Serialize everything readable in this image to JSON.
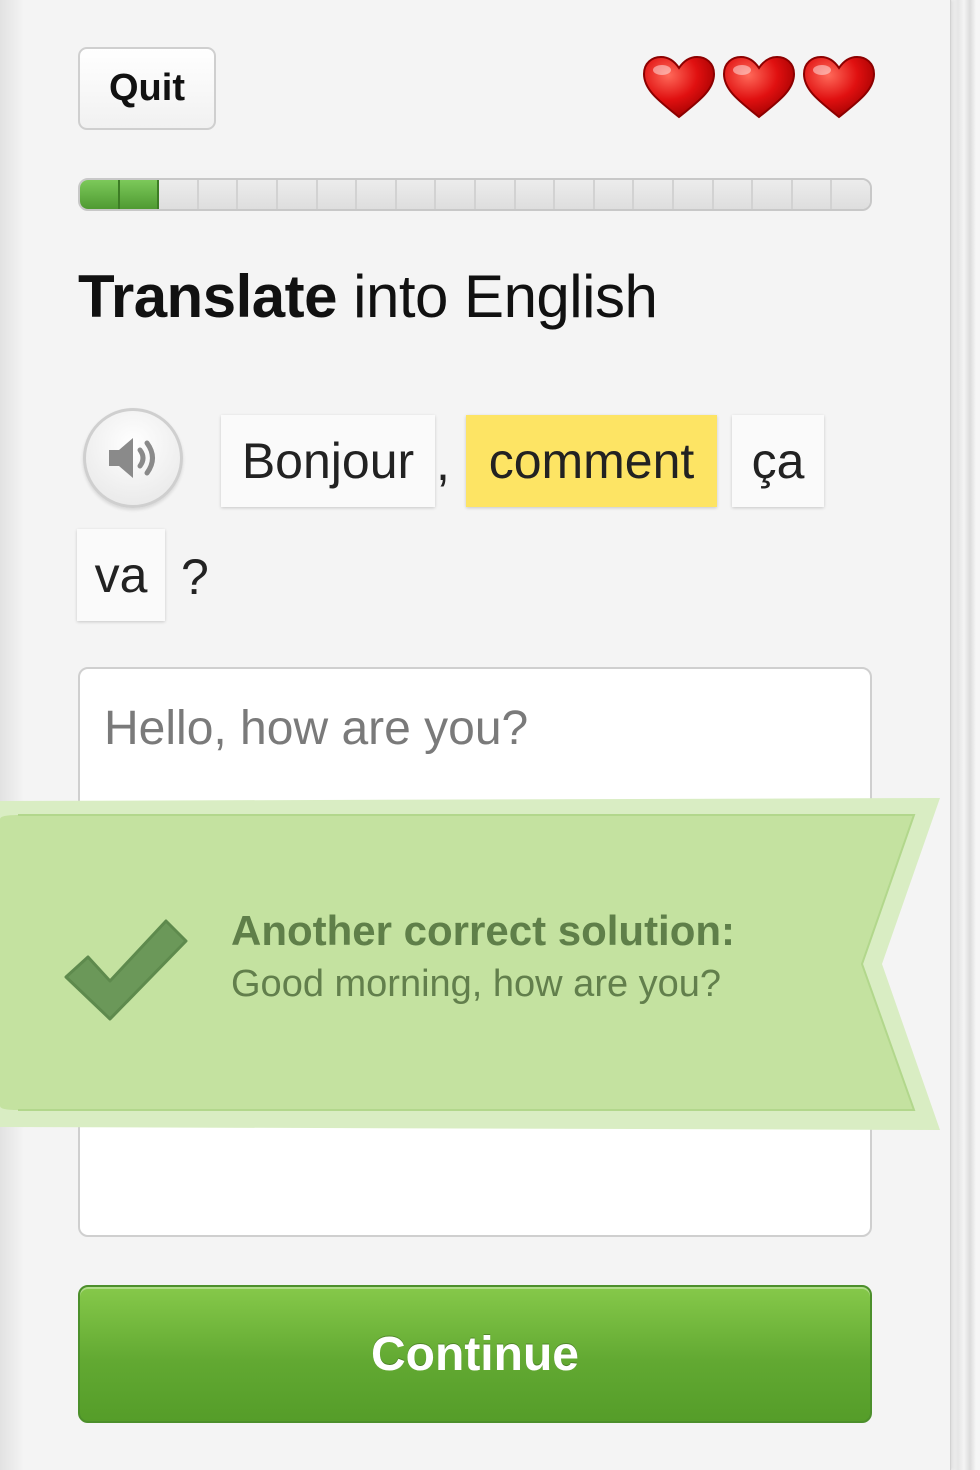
{
  "header": {
    "quit_label": "Quit",
    "hearts": {
      "count": 3,
      "icon": "heart-icon",
      "color": "#e01010"
    }
  },
  "progress": {
    "completed": 2,
    "total": 20,
    "fill_color": "#5aa83a"
  },
  "prompt": {
    "instruction_bold": "Translate",
    "instruction_rest": " into English",
    "speaker_icon": "speaker-icon",
    "tokens": [
      {
        "text": "Bonjour",
        "highlighted": false
      },
      {
        "text": ",",
        "punctuation": true
      },
      {
        "text": "comment",
        "highlighted": true
      },
      {
        "text": "ça",
        "highlighted": false
      },
      {
        "text": "va",
        "highlighted": false
      },
      {
        "text": "?",
        "punctuation": true
      }
    ],
    "highlight_color": "#fde464"
  },
  "answer": {
    "value": "Hello, how are you?"
  },
  "feedback": {
    "icon": "check-icon",
    "title": "Another correct solution:",
    "text": "Good morning, how are you?",
    "ribbon_color": "#c4e2a0"
  },
  "footer": {
    "continue_label": "Continue",
    "button_color": "#66ad36"
  }
}
